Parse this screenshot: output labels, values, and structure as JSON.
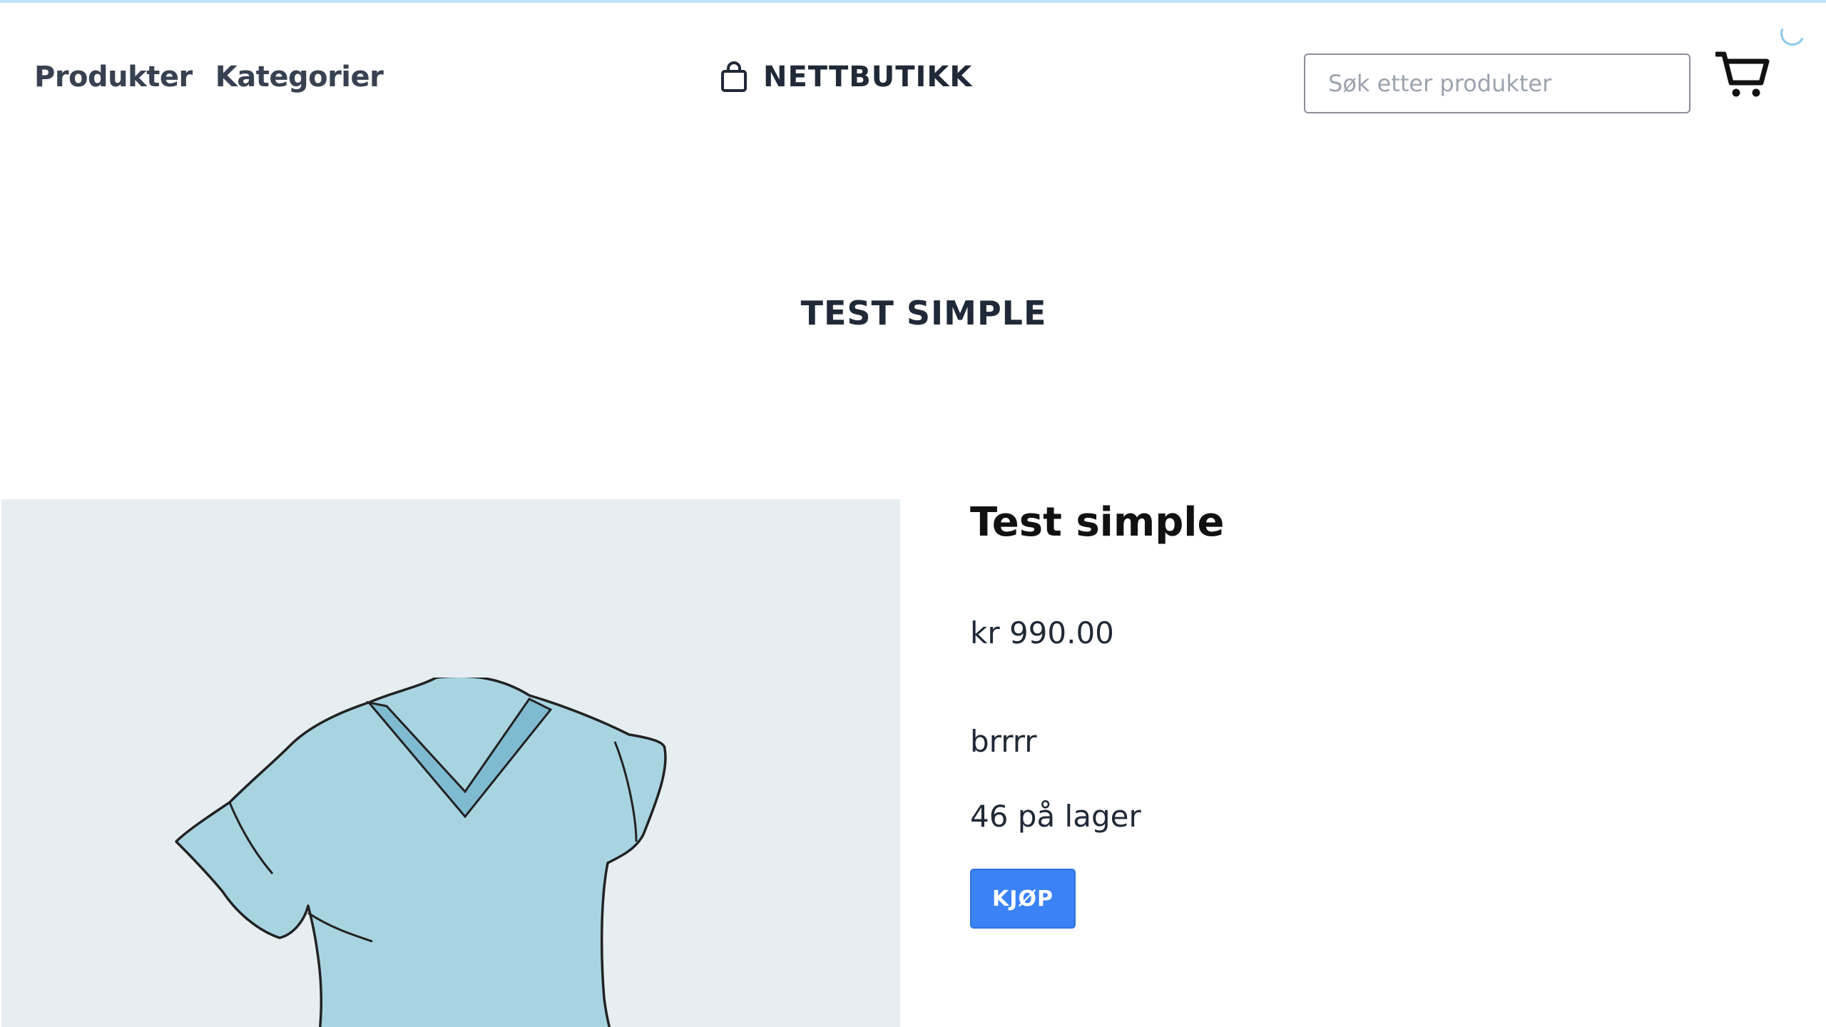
{
  "header": {
    "nav": {
      "products": "Produkter",
      "categories": "Kategorier"
    },
    "brand": {
      "name": "NETTBUTIKK",
      "icon": "shopping-bag-icon"
    },
    "search": {
      "placeholder": "Søk etter produkter",
      "value": ""
    },
    "cart": {
      "icon": "cart-icon"
    }
  },
  "page": {
    "heading": "TEST SIMPLE"
  },
  "product": {
    "title": "Test simple",
    "price": "kr 990.00",
    "description": "brrrr",
    "stock": "46 på lager",
    "buy_label": "KJØP",
    "image_subject": "t-shirt-illustration"
  },
  "colors": {
    "accent": "#3b82f6",
    "image_background": "#e7eef2",
    "shirt": "#a8d4e2"
  }
}
